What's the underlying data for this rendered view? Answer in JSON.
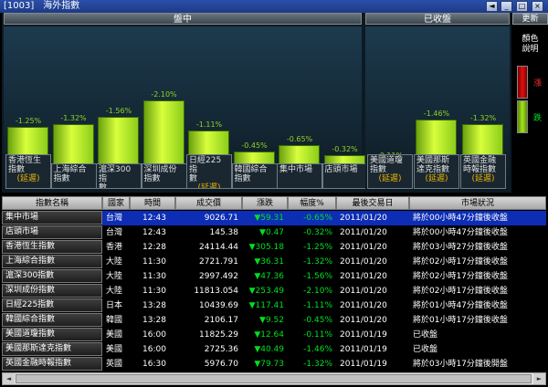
{
  "window": {
    "title": "[1003]　海外指數",
    "btn_back": "◄",
    "btn_min": "_",
    "btn_max": "□",
    "btn_close": "×"
  },
  "panels": {
    "live_header": "盤中",
    "closed_header": "已收盤",
    "update_button": "更新"
  },
  "legend": {
    "caption_line1": "顏色",
    "caption_line2": "說明",
    "up_label": "漲",
    "down_label": "跌",
    "up_color": "#e01010",
    "down_color": "#a6e61a"
  },
  "live_bars": [
    {
      "name_l1": "香港恆生",
      "name_l2": "指數",
      "delayed": "(延遲)",
      "pct": "-1.25%",
      "value": -1.25
    },
    {
      "name_l1": "上海綜合",
      "name_l2": "指數",
      "delayed": "",
      "pct": "-1.32%",
      "value": -1.32
    },
    {
      "name_l1": "滬深300指",
      "name_l2": "數",
      "delayed": "",
      "pct": "-1.56%",
      "value": -1.56
    },
    {
      "name_l1": "深圳成份",
      "name_l2": "指數",
      "delayed": "",
      "pct": "-2.10%",
      "value": -2.1
    },
    {
      "name_l1": "日經225指",
      "name_l2": "數",
      "delayed": "(延遲)",
      "pct": "-1.11%",
      "value": -1.11
    },
    {
      "name_l1": "韓國綜合",
      "name_l2": "指數",
      "delayed": "",
      "pct": "-0.45%",
      "value": -0.45
    },
    {
      "name_l1": "集中市場",
      "name_l2": "",
      "delayed": "",
      "pct": "-0.65%",
      "value": -0.65
    },
    {
      "name_l1": "店頭市場",
      "name_l2": "",
      "delayed": "",
      "pct": "-0.32%",
      "value": -0.32
    }
  ],
  "closed_bars": [
    {
      "name_l1": "美國道瓊",
      "name_l2": "指數",
      "delayed": "(延遲)",
      "pct": "-0.11%",
      "value": -0.11
    },
    {
      "name_l1": "美國那斯",
      "name_l2": "達克指數",
      "delayed": "(延遲)",
      "pct": "-1.46%",
      "value": -1.46
    },
    {
      "name_l1": "英國金融",
      "name_l2": "時報指數",
      "delayed": "(延遲)",
      "pct": "-1.32%",
      "value": -1.32
    }
  ],
  "table": {
    "headers": [
      "指數名稱",
      "國家",
      "時間",
      "成交價",
      "漲跌",
      "幅度%",
      "最後交易日",
      "市場狀況"
    ],
    "rows": [
      {
        "name": "集中市場",
        "country": "台灣",
        "time": "12:43",
        "price": "9026.71",
        "change": "▼59.31",
        "pct": "-0.65%",
        "date": "2011/01/20",
        "status": "將於00小時47分鐘後收盤",
        "selected": true
      },
      {
        "name": "店頭市場",
        "country": "台灣",
        "time": "12:43",
        "price": "145.38",
        "change": "▼0.47",
        "pct": "-0.32%",
        "date": "2011/01/20",
        "status": "將於00小時47分鐘後收盤",
        "selected": false
      },
      {
        "name": "香港恆生指數",
        "country": "香港",
        "time": "12:28",
        "price": "24114.44",
        "change": "▼305.18",
        "pct": "-1.25%",
        "date": "2011/01/20",
        "status": "將於03小時27分鐘後收盤",
        "selected": false
      },
      {
        "name": "上海綜合指數",
        "country": "大陸",
        "time": "11:30",
        "price": "2721.791",
        "change": "▼36.31",
        "pct": "-1.32%",
        "date": "2011/01/20",
        "status": "將於02小時17分鐘後收盤",
        "selected": false
      },
      {
        "name": "滬深300指數",
        "country": "大陸",
        "time": "11:30",
        "price": "2997.492",
        "change": "▼47.36",
        "pct": "-1.56%",
        "date": "2011/01/20",
        "status": "將於02小時17分鐘後收盤",
        "selected": false
      },
      {
        "name": "深圳成份指數",
        "country": "大陸",
        "time": "11:30",
        "price": "11813.054",
        "change": "▼253.49",
        "pct": "-2.10%",
        "date": "2011/01/20",
        "status": "將於02小時17分鐘後收盤",
        "selected": false
      },
      {
        "name": "日經225指數",
        "country": "日本",
        "time": "13:28",
        "price": "10439.69",
        "change": "▼117.41",
        "pct": "-1.11%",
        "date": "2011/01/20",
        "status": "將於01小時47分鐘後收盤",
        "selected": false
      },
      {
        "name": "韓國綜合指數",
        "country": "韓國",
        "time": "13:28",
        "price": "2106.17",
        "change": "▼9.52",
        "pct": "-0.45%",
        "date": "2011/01/20",
        "status": "將於01小時17分鐘後收盤",
        "selected": false
      },
      {
        "name": "美國道瓊指數",
        "country": "美國",
        "time": "16:00",
        "price": "11825.29",
        "change": "▼12.64",
        "pct": "-0.11%",
        "date": "2011/01/19",
        "status": "已收盤",
        "selected": false
      },
      {
        "name": "美國那斯達克指數",
        "country": "美國",
        "time": "16:00",
        "price": "2725.36",
        "change": "▼40.49",
        "pct": "-1.46%",
        "date": "2011/01/19",
        "status": "已收盤",
        "selected": false
      },
      {
        "name": "英國金融時報指數",
        "country": "英國",
        "time": "16:30",
        "price": "5976.70",
        "change": "▼79.73",
        "pct": "-1.32%",
        "date": "2011/01/19",
        "status": "將於03小時17分鐘後開盤",
        "selected": false
      }
    ]
  }
}
